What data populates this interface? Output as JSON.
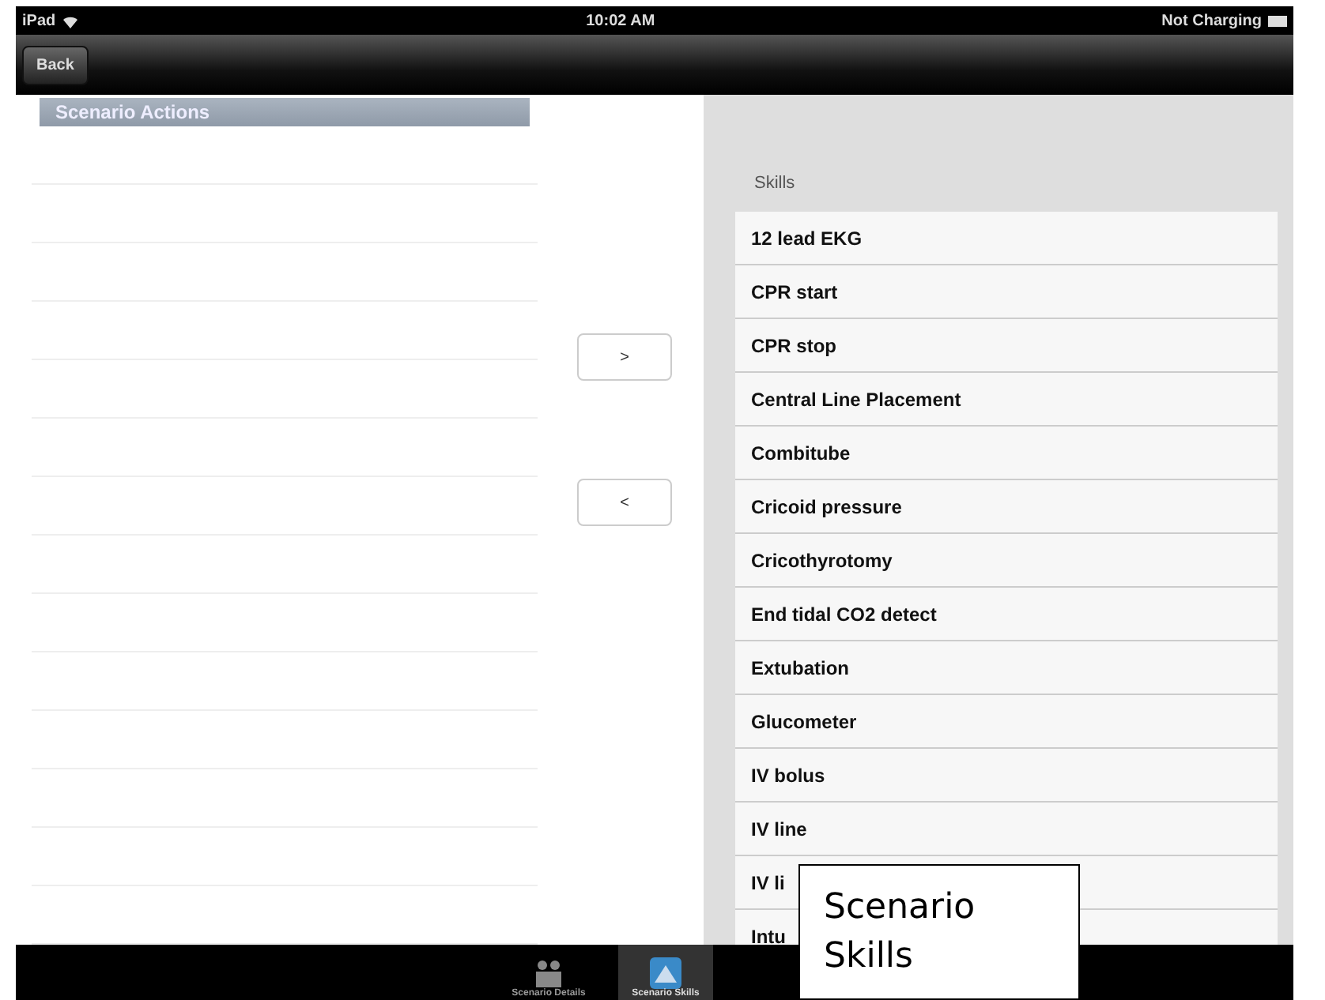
{
  "status_bar": {
    "device": "iPad",
    "time": "10:02 AM",
    "battery": "Not Charging"
  },
  "nav_bar": {
    "back": "Back"
  },
  "left_panel": {
    "title": "Scenario Actions"
  },
  "move_buttons": [
    {
      "label": ">"
    },
    {
      "label": "<"
    }
  ],
  "skills": {
    "title": "Skills",
    "items": [
      {
        "label": "12 lead EKG"
      },
      {
        "label": "CPR start"
      },
      {
        "label": "CPR stop"
      },
      {
        "label": "Central Line Placement"
      },
      {
        "label": "Combitube"
      },
      {
        "label": "Cricoid pressure"
      },
      {
        "label": "Cricothyrotomy"
      },
      {
        "label": "End tidal CO2 detect"
      },
      {
        "label": "Extubation"
      },
      {
        "label": "Glucometer"
      },
      {
        "label": "IV bolus"
      },
      {
        "label": "IV line"
      },
      {
        "label": "IV li"
      },
      {
        "label": "Intu"
      }
    ]
  },
  "tab_bar": [
    {
      "label": "Scenario Details",
      "selected": false
    },
    {
      "label": "Scenario Skills",
      "selected": true
    }
  ],
  "callout": {
    "text": "Scenario Skills"
  }
}
